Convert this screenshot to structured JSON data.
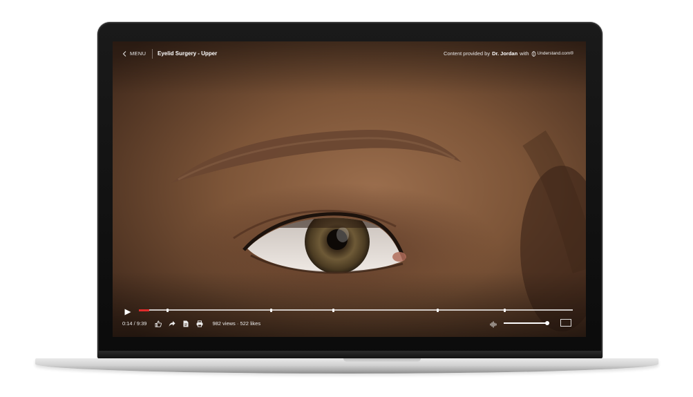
{
  "header": {
    "menu_label": "MENU",
    "title": "Eyelid Surgery - Upper",
    "provider_prefix": "Content provided by",
    "provider_name": "Dr. Jordan",
    "provider_with": "with",
    "provider_brand": "Understand.com®"
  },
  "player": {
    "current_time": "0:14",
    "duration": "9:39",
    "time_display": "0:14 / 9:39",
    "progress_fraction": 0.024,
    "chapter_fractions": [
      0.066,
      0.305,
      0.449,
      0.689,
      0.843
    ],
    "volume_fraction": 0.95,
    "views": "982 views",
    "likes": "522 likes",
    "stats_display": "982 views · 522 likes"
  },
  "icons": {
    "back": "chevron-left-icon",
    "play": "play-icon",
    "like": "thumbs-up-icon",
    "share": "share-icon",
    "document": "document-icon",
    "print": "print-icon",
    "volume": "volume-icon",
    "fullscreen": "fullscreen-icon",
    "brand": "understand-logo-icon"
  },
  "colors": {
    "progress_played": "#e02b2b",
    "control_text": "#ececec"
  }
}
